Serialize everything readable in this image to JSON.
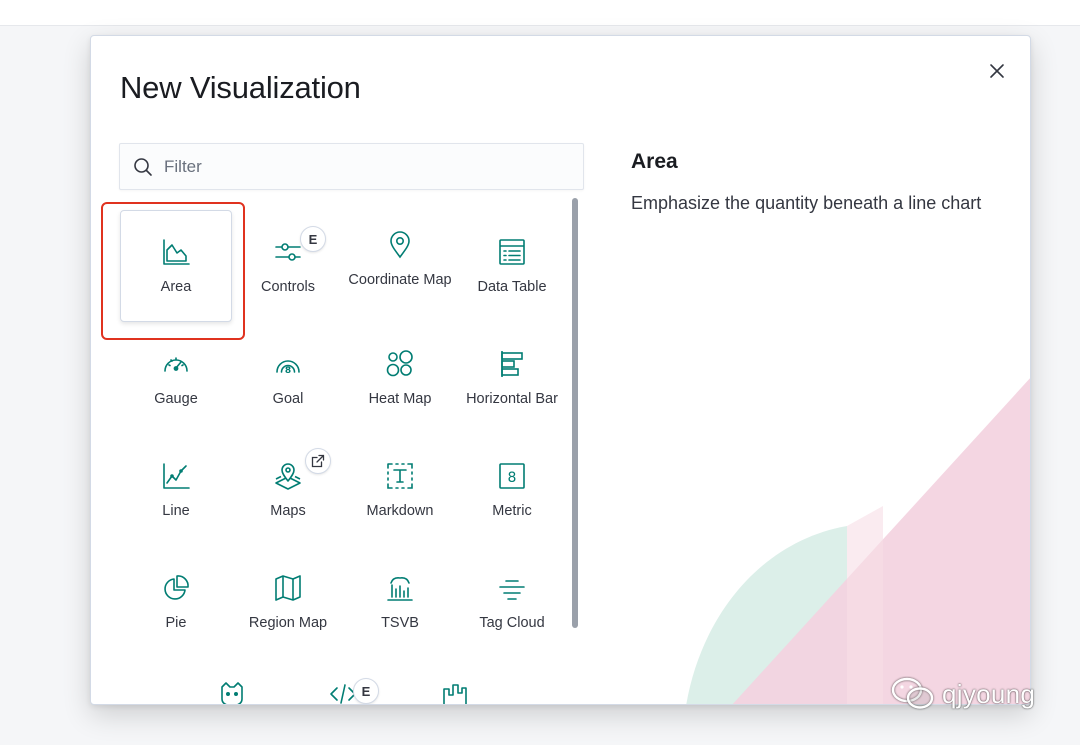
{
  "modal": {
    "title": "New Visualization",
    "close_label": "close"
  },
  "search": {
    "placeholder": "Filter",
    "value": ""
  },
  "visualizations": [
    {
      "label": "Area",
      "icon": "area-chart-icon",
      "selected": true
    },
    {
      "label": "Controls",
      "icon": "controls-icon",
      "badge": "E"
    },
    {
      "label": "Coordinate Map",
      "icon": "map-pin-icon"
    },
    {
      "label": "Data Table",
      "icon": "data-table-icon"
    },
    {
      "label": "Gauge",
      "icon": "gauge-icon"
    },
    {
      "label": "Goal",
      "icon": "goal-icon"
    },
    {
      "label": "Heat Map",
      "icon": "heat-map-icon"
    },
    {
      "label": "Horizontal Bar",
      "icon": "horizontal-bar-icon"
    },
    {
      "label": "Line",
      "icon": "line-chart-icon"
    },
    {
      "label": "Maps",
      "icon": "maps-icon",
      "badge": "external-link-icon"
    },
    {
      "label": "Markdown",
      "icon": "markdown-icon"
    },
    {
      "label": "Metric",
      "icon": "metric-icon"
    },
    {
      "label": "Pie",
      "icon": "pie-chart-icon"
    },
    {
      "label": "Region Map",
      "icon": "region-map-icon"
    },
    {
      "label": "TSVB",
      "icon": "tsvb-icon"
    },
    {
      "label": "Tag Cloud",
      "icon": "tag-cloud-icon"
    },
    {
      "label": "",
      "icon": "vega-icon"
    },
    {
      "label": "",
      "icon": "code-icon",
      "badge": "E"
    },
    {
      "label": "",
      "icon": "timeline-icon"
    }
  ],
  "description": {
    "title": "Area",
    "text": "Emphasize the quantity beneath a line chart"
  },
  "watermark": {
    "text": "qjyoung",
    "icon": "wechat-icon"
  },
  "colors": {
    "accent": "#017d73",
    "highlight": "#e0321f",
    "deco_pink": "#f3d3df",
    "deco_teal": "#dcefe9"
  }
}
